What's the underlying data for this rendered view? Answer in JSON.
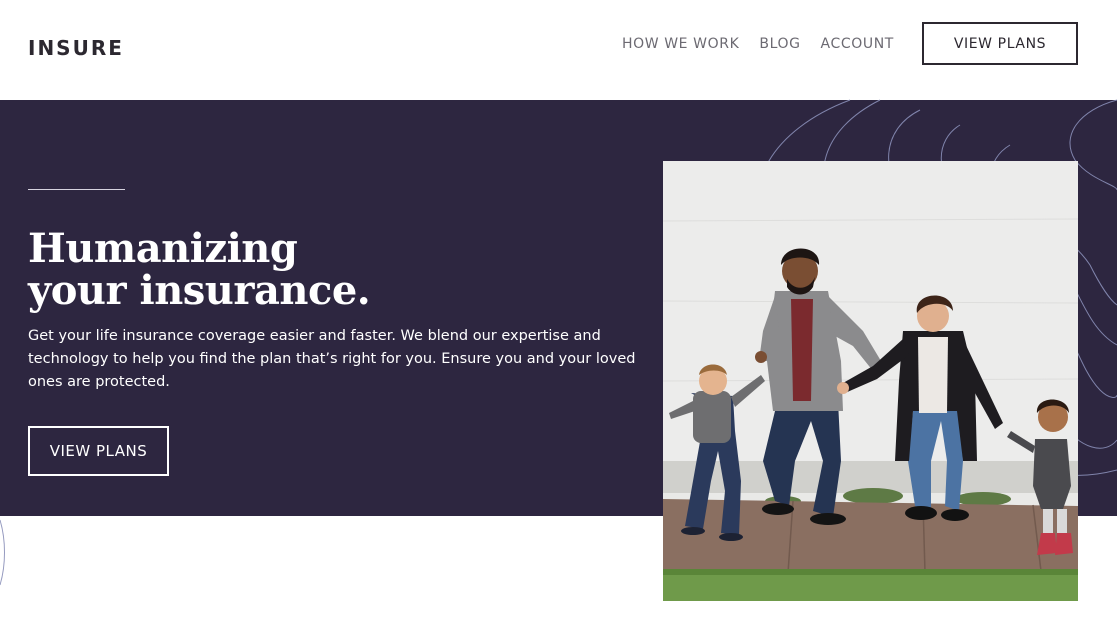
{
  "header": {
    "logo": "INSURE",
    "nav": [
      {
        "label": "HOW WE WORK"
      },
      {
        "label": "BLOG"
      },
      {
        "label": "ACCOUNT"
      }
    ],
    "cta_label": "VIEW PLANS"
  },
  "hero": {
    "title_line1": "Humanizing",
    "title_line2": "your insurance.",
    "description": "Get your life insurance coverage easier and faster. We blend our expertise and technology to help you find the plan that’s right for you. Ensure you and your loved ones are protected.",
    "cta_label": "VIEW PLANS"
  },
  "colors": {
    "hero_background": "#2d2640",
    "text_dark": "#2c2830",
    "nav_text": "#6c6a72",
    "wave_line": "#8a8fb8"
  },
  "image": {
    "subject": "family-walking-photo"
  }
}
